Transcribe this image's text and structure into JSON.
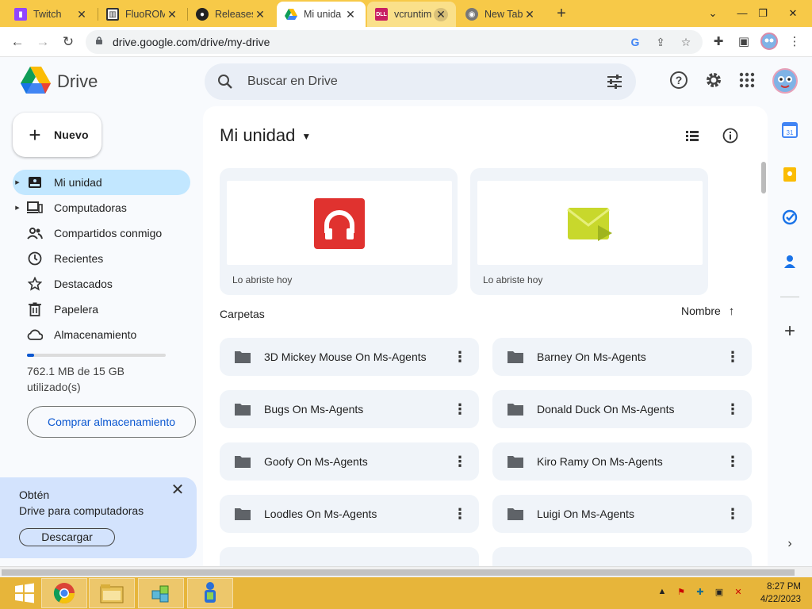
{
  "browser": {
    "tabs": [
      {
        "title": "Twitch",
        "favicon": "twitch-icon",
        "color": "#9146ff"
      },
      {
        "title": "FluoROM",
        "favicon": "fluorom-icon",
        "color": "#333333"
      },
      {
        "title": "Releases",
        "favicon": "github-icon",
        "color": "#222222"
      },
      {
        "title": "Mi unida",
        "favicon": "drive-icon",
        "color": "#1a73e8"
      },
      {
        "title": "vcruntim",
        "favicon": "dll-icon",
        "color": "#c81e63"
      },
      {
        "title": "New Tab",
        "favicon": "chrome-icon",
        "color": "#666666"
      }
    ],
    "url": "drive.google.com/drive/my-drive"
  },
  "drive": {
    "brand": "Drive",
    "search_placeholder": "Buscar en Drive",
    "new_label": "Nuevo",
    "nav": [
      {
        "label": "Mi unidad",
        "icon": "my-drive-icon"
      },
      {
        "label": "Computadoras",
        "icon": "computers-icon"
      },
      {
        "label": "Compartidos conmigo",
        "icon": "shared-icon"
      },
      {
        "label": "Recientes",
        "icon": "clock-icon"
      },
      {
        "label": "Destacados",
        "icon": "star-icon"
      },
      {
        "label": "Papelera",
        "icon": "trash-icon"
      },
      {
        "label": "Almacenamiento",
        "icon": "cloud-icon"
      }
    ],
    "storage_text": "762.1 MB de 15 GB utilizado(s)",
    "storage_used_fraction": 0.05,
    "buy_storage": "Comprar almacenamiento",
    "promo": {
      "line1": "Obtén",
      "line2": "Drive para computadoras",
      "button": "Descargar"
    },
    "page_title": "Mi unidad",
    "recent": [
      {
        "caption": "Lo abriste hoy"
      },
      {
        "caption": "Lo abriste hoy"
      }
    ],
    "section_title": "Carpetas",
    "sort_label": "Nombre",
    "folders": [
      "3D Mickey Mouse On Ms-Agents",
      "Barney On Ms-Agents",
      "Bugs On Ms-Agents",
      "Donald Duck On Ms-Agents",
      "Goofy On Ms-Agents",
      "Kiro Ramy On Ms-Agents",
      "Loodles On Ms-Agents",
      "Luigi On Ms-Agents"
    ]
  },
  "taskbar": {
    "time": "8:27 PM",
    "date": "4/22/2023"
  }
}
